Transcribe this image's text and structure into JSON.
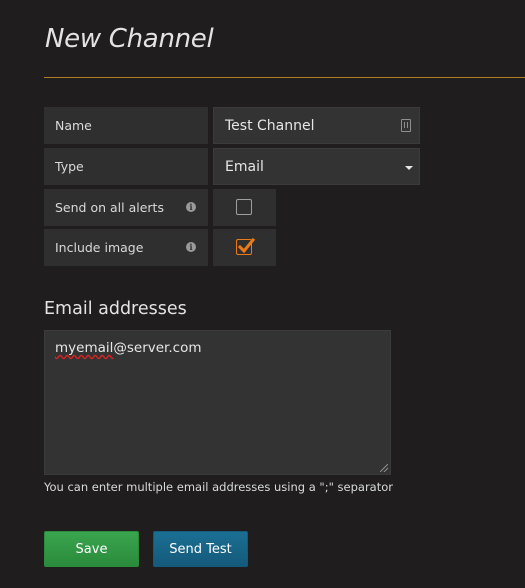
{
  "page": {
    "title": "New Channel"
  },
  "form": {
    "name": {
      "label": "Name",
      "value": "Test Channel",
      "icon": "contact-card-icon"
    },
    "type": {
      "label": "Type",
      "value": "Email",
      "icon": "caret-down-icon"
    },
    "send_on_all_alerts": {
      "label": "Send on all alerts",
      "checked": false,
      "icon": "info-icon"
    },
    "include_image": {
      "label": "Include image",
      "checked": true,
      "icon": "info-icon"
    }
  },
  "email": {
    "section_title": "Email addresses",
    "value_user": "myemail",
    "value_domain": "@server.com",
    "help": "You can enter multiple email addresses using a \";\" separator"
  },
  "buttons": {
    "save": "Save",
    "send_test": "Send Test"
  },
  "colors": {
    "accent_rule": "#b47c24",
    "checkbox_checked": "#eb7b18",
    "save_button": "#2a8b3b",
    "send_test_button": "#145a7b"
  }
}
